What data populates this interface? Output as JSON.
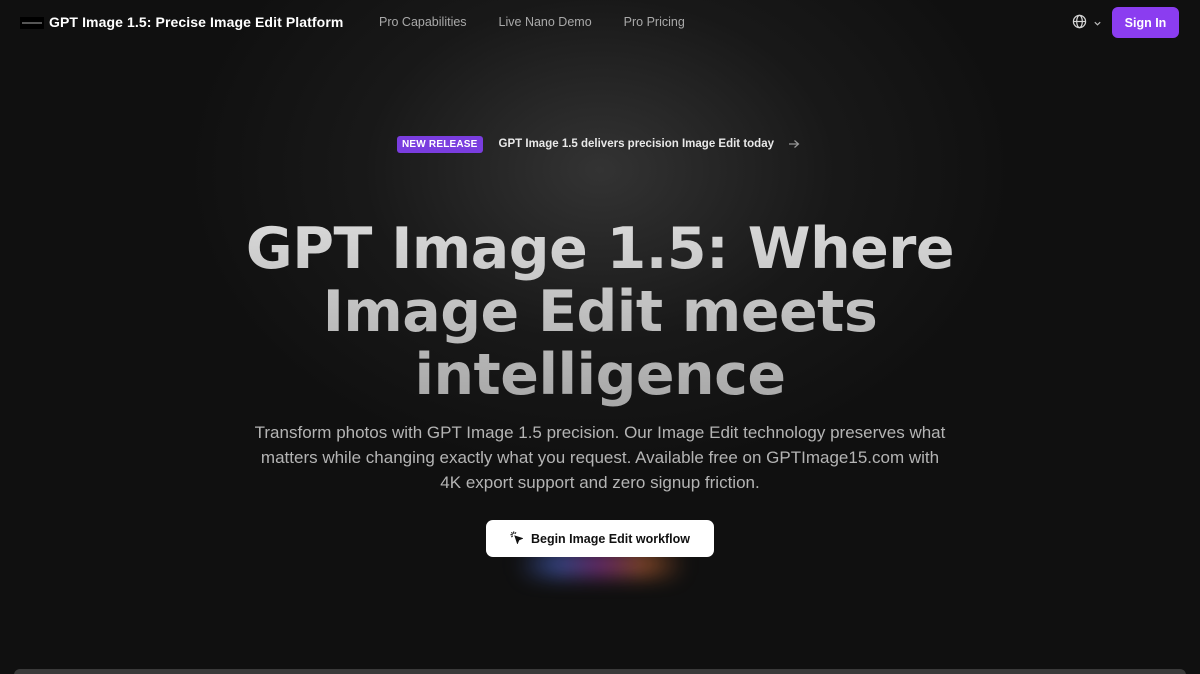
{
  "nav": {
    "brand": "GPT Image 1.5: Precise Image Edit Platform",
    "links": [
      "Pro Capabilities",
      "Live Nano Demo",
      "Pro Pricing"
    ],
    "sign_in_label": "Sign In",
    "language_icon": "globe-icon"
  },
  "announcement": {
    "badge": "NEW RELEASE",
    "text": "GPT Image 1.5 delivers precision Image Edit today"
  },
  "hero": {
    "title_line1": "GPT Image 1.5: Where",
    "title_line2": "Image Edit meets",
    "title_line3": "intelligence",
    "subtitle": "Transform photos with GPT Image 1.5 precision. Our Image Edit technology preserves what matters while changing exactly what you request. Available free on GPTImage15.com with 4K export support and zero signup friction.",
    "cta_label": "Begin Image Edit workflow"
  },
  "colors": {
    "accent": "#8b3df0",
    "badge": "#7a3ddf",
    "background": "#101010"
  }
}
